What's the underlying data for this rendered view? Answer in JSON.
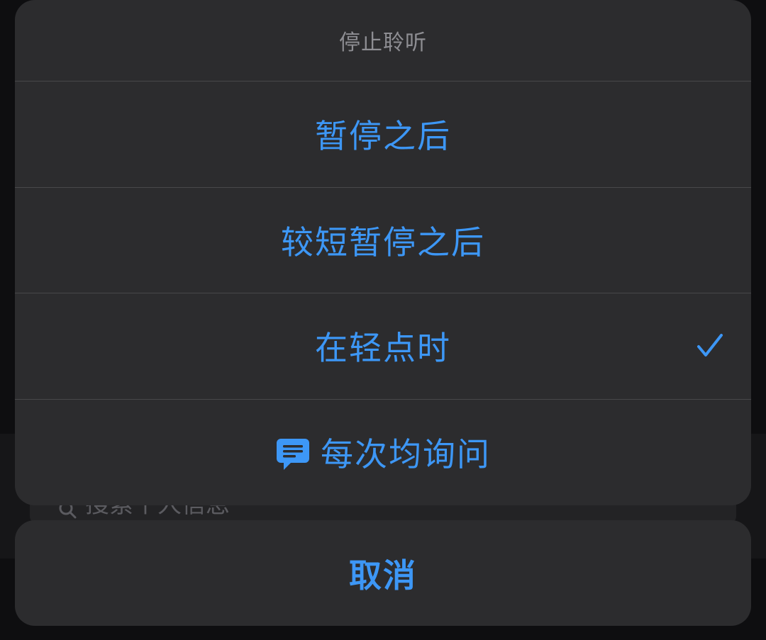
{
  "background": {
    "search_placeholder": "搜索个人信息"
  },
  "sheet": {
    "title": "停止聆听",
    "options": [
      {
        "label": "暂停之后",
        "selected": false
      },
      {
        "label": "较短暂停之后",
        "selected": false
      },
      {
        "label": "在轻点时",
        "selected": true
      },
      {
        "label": "每次均询问",
        "selected": false,
        "icon": "message-bubble-icon"
      }
    ]
  },
  "cancel_label": "取消",
  "colors": {
    "accent": "#3d97f6",
    "sheet_bg": "#2c2c2e",
    "title_text": "#8e8e93",
    "separator": "#48484a"
  }
}
